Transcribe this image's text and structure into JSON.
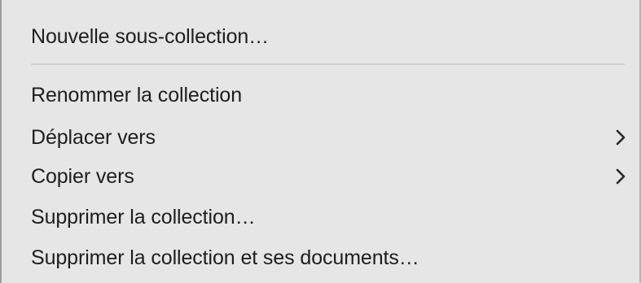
{
  "menu": {
    "items": [
      {
        "label": "Nouvelle sous-collection…",
        "submenu": false
      },
      {
        "label": "Renommer la collection",
        "submenu": false
      },
      {
        "label": "Déplacer vers",
        "submenu": true,
        "icon": "chevron-right-icon"
      },
      {
        "label": "Copier vers",
        "submenu": true,
        "icon": "chevron-right-icon"
      },
      {
        "label": "Supprimer la collection…",
        "submenu": false
      },
      {
        "label": "Supprimer la collection et ses documents…",
        "submenu": false
      }
    ]
  },
  "colors": {
    "menu_background": "#e6e6e6",
    "text": "#1e1e1e",
    "separator": "#cfcfcf"
  }
}
